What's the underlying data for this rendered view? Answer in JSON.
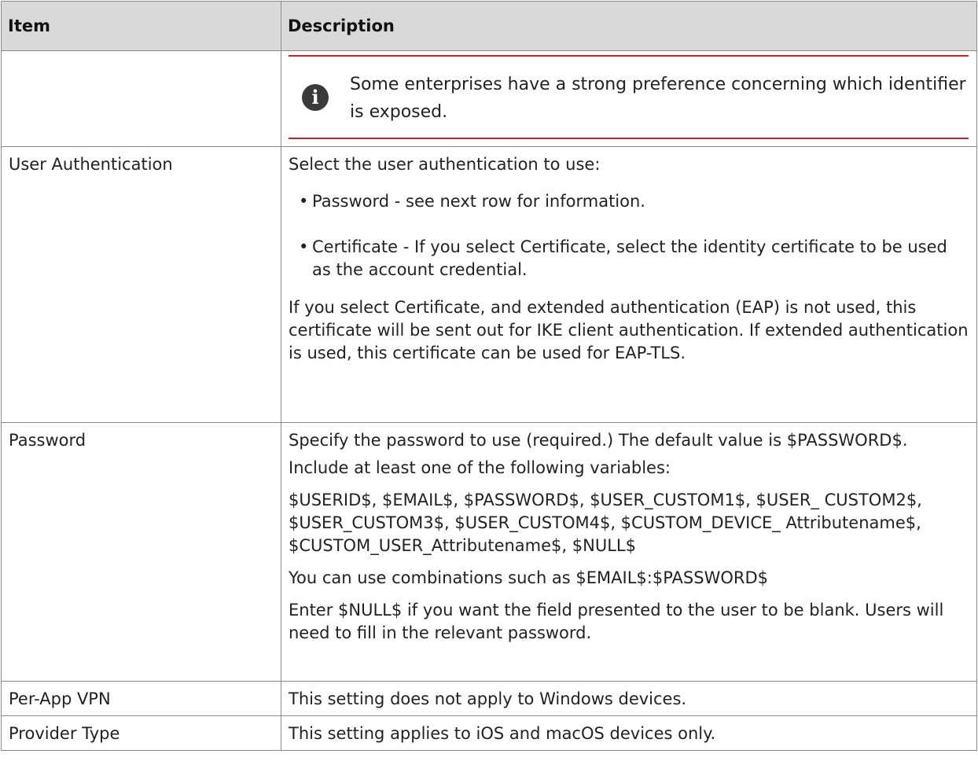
{
  "table": {
    "headers": {
      "item": "Item",
      "description": "Description"
    },
    "note": {
      "icon": "info-icon",
      "text": "Some enterprises have a strong preference concerning which identifier is exposed.",
      "accent_color": "#cc2027"
    },
    "rows": [
      {
        "item": "User Authentication",
        "intro": "Select the user authentication to use:",
        "bullets": [
          "Password - see next row for information.",
          "Certificate - If you select Certificate, select the identity certificate to be used as the account credential."
        ],
        "outro": "If you select Certificate, and extended authentication (EAP) is not used, this certificate will be sent out for IKE client authentication. If extended authentication is used, this certificate can be used for EAP-TLS."
      },
      {
        "item": "Password",
        "paragraphs": [
          "Specify the password to use (required.) The default value is $PASSWORD$.",
          "Include at least one of the following variables:",
          "$USERID$, $EMAIL$, $PASSWORD$, $USER_CUSTOM1$, $USER_ CUSTOM2$, $USER_CUSTOM3$, $USER_CUSTOM4$, $CUSTOM_DEVICE_ Attributename$, $CUSTOM_USER_Attributename$, $NULL$",
          "You can use combinations such as $EMAIL$:$PASSWORD$",
          "Enter $NULL$ if you want the field presented to the user to be blank. Users will need to fill in the relevant password."
        ]
      },
      {
        "item": "Per-App VPN",
        "description": "This setting does not apply to Windows devices."
      },
      {
        "item": "Provider Type",
        "description": "This setting applies to iOS and macOS devices only."
      }
    ]
  }
}
